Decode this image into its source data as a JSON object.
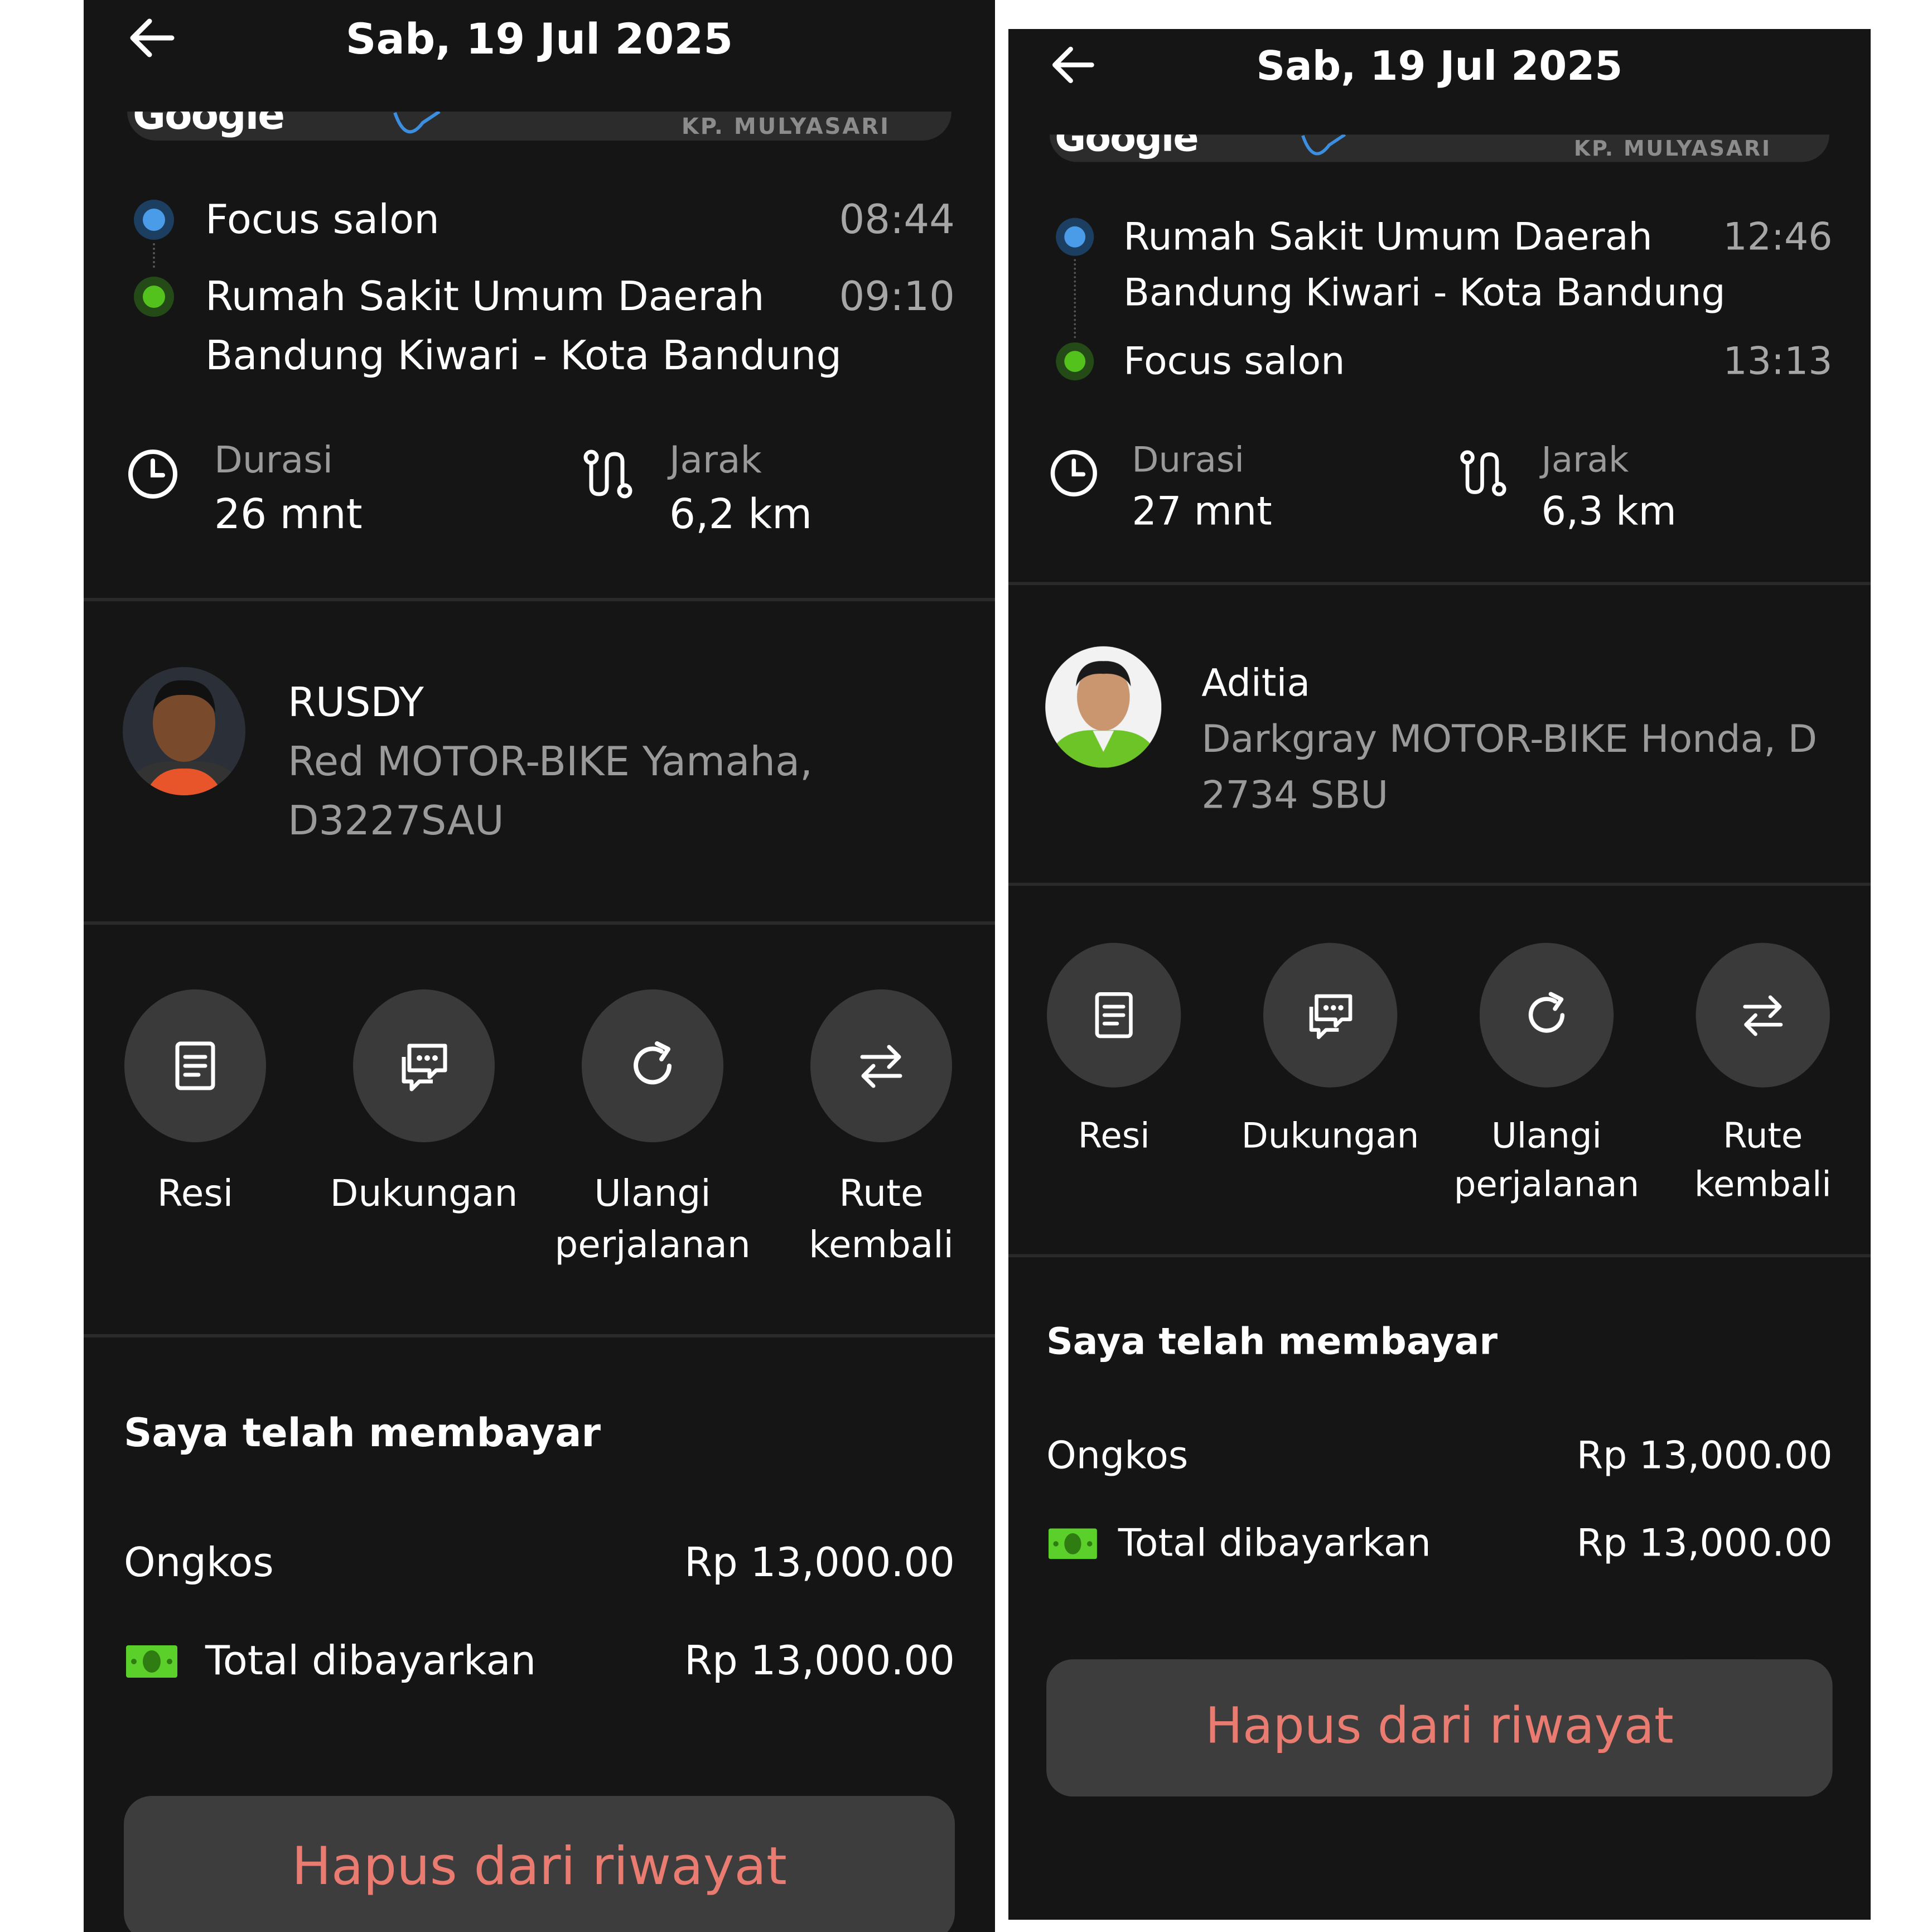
{
  "panels": [
    {
      "header": {
        "title": "Sab, 19 Jul 2025"
      },
      "map": {
        "logo_text": "Google",
        "place_label": "KP. MULYASARI"
      },
      "route": {
        "pickup": {
          "name": "Focus salon",
          "time": "08:44"
        },
        "dropoff": {
          "name": "Rumah Sakit Umum Daerah Bandung Kiwari - Kota Bandung",
          "time": "09:10"
        }
      },
      "stats": {
        "duration_label": "Durasi",
        "duration_value": "26 mnt",
        "distance_label": "Jarak",
        "distance_value": "6,2 km"
      },
      "driver": {
        "name": "RUSDY",
        "vehicle": "Red MOTOR-BIKE Yamaha, D3227SAU",
        "jacket_color": "#e8552a"
      },
      "actions": [
        {
          "label": "Resi",
          "icon": "receipt-icon"
        },
        {
          "label": "Dukungan",
          "icon": "chat-icon"
        },
        {
          "label": "Ulangi perjalanan",
          "icon": "refresh-icon"
        },
        {
          "label": "Rute kembali",
          "icon": "swap-icon"
        }
      ],
      "payment": {
        "title": "Saya telah membayar",
        "fare_label": "Ongkos",
        "fare_value": "Rp 13,000.00",
        "total_label": "Total dibayarkan",
        "total_value": "Rp 13,000.00"
      },
      "delete_label": "Hapus dari riwayat"
    },
    {
      "header": {
        "title": "Sab, 19 Jul 2025"
      },
      "map": {
        "logo_text": "Google",
        "place_label": "KP. MULYASARI"
      },
      "route": {
        "pickup": {
          "name": "Rumah Sakit Umum Daerah Bandung Kiwari - Kota Bandung",
          "time": "12:46"
        },
        "dropoff": {
          "name": "Focus salon",
          "time": "13:13"
        }
      },
      "stats": {
        "duration_label": "Durasi",
        "duration_value": "27 mnt",
        "distance_label": "Jarak",
        "distance_value": "6,3 km"
      },
      "driver": {
        "name": "Aditia",
        "vehicle": "Darkgray MOTOR-BIKE Honda, D 2734 SBU",
        "jacket_color": "#6cc427"
      },
      "actions": [
        {
          "label": "Resi",
          "icon": "receipt-icon"
        },
        {
          "label": "Dukungan",
          "icon": "chat-icon"
        },
        {
          "label": "Ulangi perjalanan",
          "icon": "refresh-icon"
        },
        {
          "label": "Rute kembali",
          "icon": "swap-icon"
        }
      ],
      "payment": {
        "title": "Saya telah membayar",
        "fare_label": "Ongkos",
        "fare_value": "Rp 13,000.00",
        "total_label": "Total dibayarkan",
        "total_value": "Rp 13,000.00"
      },
      "delete_label": "Hapus dari riwayat"
    }
  ],
  "colors": {
    "background": "#151515",
    "pickup_dot": "#4a9be8",
    "dropoff_dot": "#54c21d",
    "delete_text": "#ea7b70",
    "button_circle": "#3a3a3a",
    "cash_green": "#5cd02a"
  }
}
